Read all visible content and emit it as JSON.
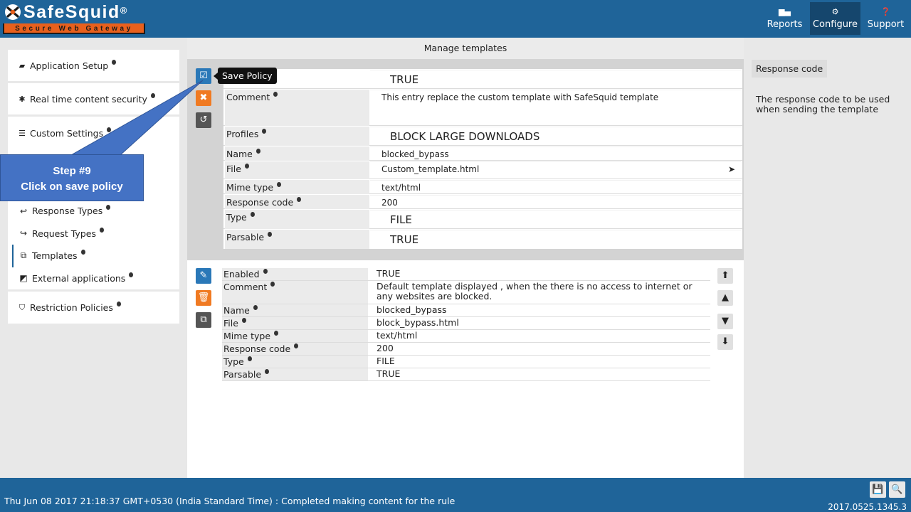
{
  "brand": {
    "name": "SafeSquid",
    "reg": "®",
    "tagline": "Secure Web Gateway",
    "accent": "#1f6499",
    "orange": "#e8601c"
  },
  "topnav": [
    {
      "label": "Reports",
      "icon": "chart-icon"
    },
    {
      "label": "Configure",
      "icon": "gears-icon",
      "active": true
    },
    {
      "label": "Support",
      "icon": "question-icon"
    }
  ],
  "sidebar": {
    "sections_top": [
      {
        "label": "Application Setup",
        "icon": "briefcase-icon"
      },
      {
        "label": "Real time content security",
        "icon": "bug-icon"
      },
      {
        "label": "Custom Settings",
        "icon": "sliders-icon"
      }
    ],
    "sub_items": [
      {
        "label": "Response Types",
        "icon": "reply-icon"
      },
      {
        "label": "Request Types",
        "icon": "share-icon"
      },
      {
        "label": "Templates",
        "icon": "template-icon",
        "active": true
      },
      {
        "label": "External applications",
        "icon": "external-icon"
      }
    ],
    "sections_bottom": [
      {
        "label": "Restriction Policies",
        "icon": "shield-icon"
      }
    ]
  },
  "main": {
    "title": "Manage templates",
    "tooltip": "Save Policy",
    "edit_form": {
      "enabled": "TRUE",
      "comment_label": "Comment",
      "comment": "This entry replace the custom template with SafeSquid template",
      "profiles_label": "Profiles",
      "profiles": "BLOCK LARGE DOWNLOADS",
      "name_label": "Name",
      "name": "blocked_bypass",
      "file_label": "File",
      "file": "Custom_template.html",
      "mime_label": "Mime type",
      "mime": "text/html",
      "response_label": "Response code",
      "response": "200",
      "type_label": "Type",
      "type": "FILE",
      "parsable_label": "Parsable",
      "parsable": "TRUE"
    },
    "view_form": {
      "enabled_label": "Enabled",
      "enabled": "TRUE",
      "comment_label": "Comment",
      "comment": "Default template displayed , when the there is no access to internet or any websites are blocked.",
      "name_label": "Name",
      "name": "blocked_bypass",
      "file_label": "File",
      "file": "block_bypass.html",
      "mime_label": "Mime type",
      "mime": "text/html",
      "response_label": "Response code",
      "response": "200",
      "type_label": "Type",
      "type": "FILE",
      "parsable_label": "Parsable",
      "parsable": "TRUE"
    }
  },
  "right_panel": {
    "tag": "Response code",
    "description": "The response code to be used when sending the template"
  },
  "callout": {
    "step": "Step #9",
    "text": "Click on save policy"
  },
  "footer": {
    "status": "Thu Jun 08 2017 21:18:37 GMT+0530 (India Standard Time) : Completed making content for the rule",
    "version": "2017.0525.1345.3"
  }
}
